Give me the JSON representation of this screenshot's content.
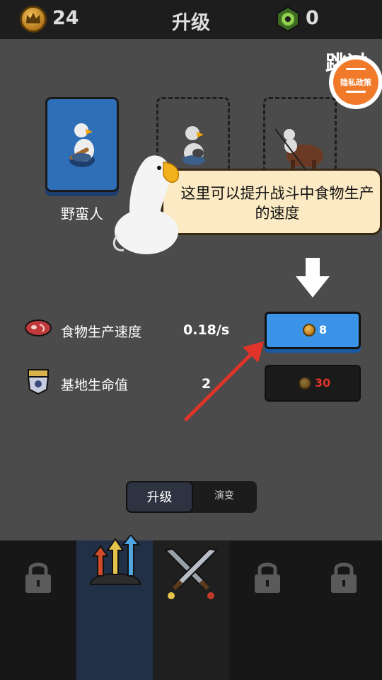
{
  "header": {
    "coins": "24",
    "title": "升级",
    "gems": "0"
  },
  "skip_label": "跳过",
  "privacy_label": "隐私政策",
  "units": {
    "selected_name": "野蛮人"
  },
  "tutorial": {
    "text": "这里可以提升战斗中食物生产的速度"
  },
  "stats": [
    {
      "label": "食物生产速度",
      "value": "0.18/s",
      "cost": "8",
      "affordable": true
    },
    {
      "label": "基地生命值",
      "value": "2",
      "cost": "30",
      "affordable": false
    }
  ],
  "tabs": [
    {
      "label": "升级"
    },
    {
      "label": "演变"
    }
  ],
  "bottom_nav": [
    {
      "icon": "lock-icon",
      "locked": true
    },
    {
      "icon": "upgrade-arrows-icon",
      "locked": false
    },
    {
      "icon": "crossed-swords-icon",
      "locked": false
    },
    {
      "icon": "lock-icon",
      "locked": true
    },
    {
      "icon": "lock-icon",
      "locked": true
    }
  ],
  "colors": {
    "accent_blue": "#3a93e6",
    "bubble": "#fbeac3",
    "privacy": "#f07a2a",
    "cost_red": "#e0342a"
  }
}
